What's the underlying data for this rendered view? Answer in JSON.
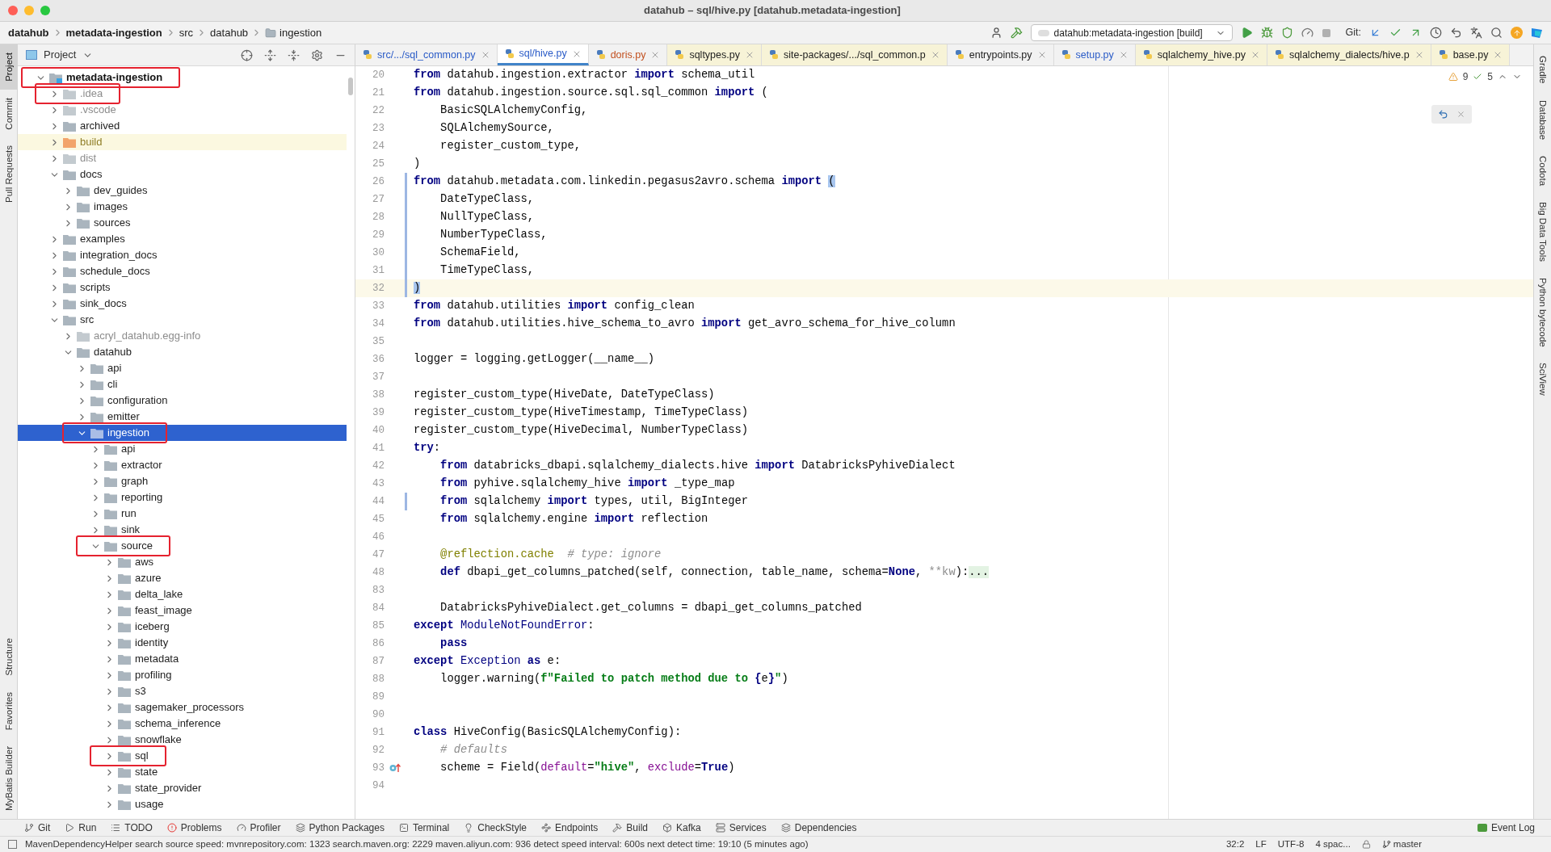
{
  "window": {
    "title": "datahub – sql/hive.py [datahub.metadata-ingestion]"
  },
  "breadcrumbs": [
    {
      "label": "datahub",
      "kind": "project"
    },
    {
      "label": "metadata-ingestion",
      "kind": "project"
    },
    {
      "label": "src",
      "kind": "package"
    },
    {
      "label": "datahub",
      "kind": "package"
    },
    {
      "label": "ingestion",
      "kind": "folder"
    }
  ],
  "toolbar": {
    "run_config": "datahub:metadata-ingestion [build]",
    "vcs_label": "Git:"
  },
  "left_strip": {
    "top": [
      {
        "label": "Project",
        "selected": true
      },
      {
        "label": "Commit",
        "selected": false
      },
      {
        "label": "Pull Requests",
        "selected": false
      }
    ],
    "bottom": [
      {
        "label": "Structure",
        "selected": false
      },
      {
        "label": "Favorites",
        "selected": false
      },
      {
        "label": "MyBatis Builder",
        "selected": false
      }
    ]
  },
  "project_panel": {
    "title": "Project",
    "tree": [
      {
        "name": "metadata-ingestion",
        "kind": "module",
        "expanded": true,
        "selected": false,
        "marked": true,
        "children": [
          {
            "name": ".idea",
            "kind": "excluded",
            "expanded": false,
            "selected": false,
            "marked": true
          },
          {
            "name": ".vscode",
            "kind": "excluded",
            "expanded": false,
            "selected": false,
            "marked": false
          },
          {
            "name": "archived",
            "kind": "folder",
            "expanded": false,
            "selected": false,
            "marked": false
          },
          {
            "name": "build",
            "kind": "output",
            "expanded": false,
            "selected": false,
            "marked": false
          },
          {
            "name": "dist",
            "kind": "excluded",
            "expanded": false,
            "selected": false,
            "marked": false
          },
          {
            "name": "docs",
            "kind": "folder",
            "expanded": true,
            "selected": false,
            "marked": false,
            "children": [
              {
                "name": "dev_guides",
                "kind": "folder",
                "expanded": false,
                "selected": false,
                "marked": false
              },
              {
                "name": "images",
                "kind": "folder",
                "expanded": false,
                "selected": false,
                "marked": false
              },
              {
                "name": "sources",
                "kind": "folder",
                "expanded": false,
                "selected": false,
                "marked": false
              }
            ]
          },
          {
            "name": "examples",
            "kind": "folder",
            "expanded": false,
            "selected": false,
            "marked": false
          },
          {
            "name": "integration_docs",
            "kind": "folder",
            "expanded": false,
            "selected": false,
            "marked": false
          },
          {
            "name": "schedule_docs",
            "kind": "folder",
            "expanded": false,
            "selected": false,
            "marked": false
          },
          {
            "name": "scripts",
            "kind": "folder",
            "expanded": false,
            "selected": false,
            "marked": false
          },
          {
            "name": "sink_docs",
            "kind": "folder",
            "expanded": false,
            "selected": false,
            "marked": false
          },
          {
            "name": "src",
            "kind": "folder",
            "expanded": true,
            "selected": false,
            "marked": false,
            "children": [
              {
                "name": "acryl_datahub.egg-info",
                "kind": "excluded",
                "expanded": false,
                "selected": false,
                "marked": false
              },
              {
                "name": "datahub",
                "kind": "folder",
                "expanded": true,
                "selected": false,
                "marked": false,
                "children": [
                  {
                    "name": "api",
                    "kind": "folder",
                    "expanded": false,
                    "selected": false,
                    "marked": false
                  },
                  {
                    "name": "cli",
                    "kind": "folder",
                    "expanded": false,
                    "selected": false,
                    "marked": false
                  },
                  {
                    "name": "configuration",
                    "kind": "folder",
                    "expanded": false,
                    "selected": false,
                    "marked": false
                  },
                  {
                    "name": "emitter",
                    "kind": "folder",
                    "expanded": false,
                    "selected": false,
                    "marked": false
                  },
                  {
                    "name": "ingestion",
                    "kind": "folder",
                    "expanded": true,
                    "selected": true,
                    "marked": true,
                    "children": [
                      {
                        "name": "api",
                        "kind": "folder",
                        "expanded": false,
                        "selected": false,
                        "marked": false
                      },
                      {
                        "name": "extractor",
                        "kind": "folder",
                        "expanded": false,
                        "selected": false,
                        "marked": false
                      },
                      {
                        "name": "graph",
                        "kind": "folder",
                        "expanded": false,
                        "selected": false,
                        "marked": false
                      },
                      {
                        "name": "reporting",
                        "kind": "folder",
                        "expanded": false,
                        "selected": false,
                        "marked": false
                      },
                      {
                        "name": "run",
                        "kind": "folder",
                        "expanded": false,
                        "selected": false,
                        "marked": false
                      },
                      {
                        "name": "sink",
                        "kind": "folder",
                        "expanded": false,
                        "selected": false,
                        "marked": false
                      },
                      {
                        "name": "source",
                        "kind": "folder",
                        "expanded": true,
                        "selected": false,
                        "marked": true,
                        "children": [
                          {
                            "name": "aws",
                            "kind": "folder",
                            "expanded": false,
                            "selected": false,
                            "marked": false
                          },
                          {
                            "name": "azure",
                            "kind": "folder",
                            "expanded": false,
                            "selected": false,
                            "marked": false
                          },
                          {
                            "name": "delta_lake",
                            "kind": "folder",
                            "expanded": false,
                            "selected": false,
                            "marked": false
                          },
                          {
                            "name": "feast_image",
                            "kind": "folder",
                            "expanded": false,
                            "selected": false,
                            "marked": false
                          },
                          {
                            "name": "iceberg",
                            "kind": "folder",
                            "expanded": false,
                            "selected": false,
                            "marked": false
                          },
                          {
                            "name": "identity",
                            "kind": "folder",
                            "expanded": false,
                            "selected": false,
                            "marked": false
                          },
                          {
                            "name": "metadata",
                            "kind": "folder",
                            "expanded": false,
                            "selected": false,
                            "marked": false
                          },
                          {
                            "name": "profiling",
                            "kind": "folder",
                            "expanded": false,
                            "selected": false,
                            "marked": false
                          },
                          {
                            "name": "s3",
                            "kind": "folder",
                            "expanded": false,
                            "selected": false,
                            "marked": false
                          },
                          {
                            "name": "sagemaker_processors",
                            "kind": "folder",
                            "expanded": false,
                            "selected": false,
                            "marked": false
                          },
                          {
                            "name": "schema_inference",
                            "kind": "folder",
                            "expanded": false,
                            "selected": false,
                            "marked": false
                          },
                          {
                            "name": "snowflake",
                            "kind": "folder",
                            "expanded": false,
                            "selected": false,
                            "marked": false
                          },
                          {
                            "name": "sql",
                            "kind": "folder",
                            "expanded": false,
                            "selected": false,
                            "marked": true
                          },
                          {
                            "name": "state",
                            "kind": "folder",
                            "expanded": false,
                            "selected": false,
                            "marked": false
                          },
                          {
                            "name": "state_provider",
                            "kind": "folder",
                            "expanded": false,
                            "selected": false,
                            "marked": false
                          },
                          {
                            "name": "usage",
                            "kind": "folder",
                            "expanded": false,
                            "selected": false,
                            "marked": false
                          }
                        ]
                      }
                    ]
                  }
                ]
              }
            ]
          }
        ]
      }
    ]
  },
  "editor": {
    "tabs": [
      {
        "label": "src/.../sql_common.py",
        "selected": false,
        "kind": "modified",
        "external": false
      },
      {
        "label": "sql/hive.py",
        "selected": true,
        "kind": "modified"
      },
      {
        "label": "doris.py",
        "selected": false,
        "kind": "unversioned",
        "external": false
      },
      {
        "label": "sqltypes.py",
        "selected": false,
        "kind": "normal",
        "external": true
      },
      {
        "label": "site-packages/.../sql_common.p",
        "selected": false,
        "kind": "normal",
        "external": true
      },
      {
        "label": "entrypoints.py",
        "selected": false,
        "kind": "normal",
        "external": false
      },
      {
        "label": "setup.py",
        "selected": false,
        "kind": "modified",
        "external": false
      },
      {
        "label": "sqlalchemy_hive.py",
        "selected": false,
        "kind": "normal",
        "external": true
      },
      {
        "label": "sqlalchemy_dialects/hive.p",
        "selected": false,
        "kind": "normal",
        "external": true
      },
      {
        "label": "base.py",
        "selected": false,
        "kind": "normal",
        "external": true
      }
    ],
    "inspections": {
      "warnings": "9",
      "checks": "5"
    },
    "lines": [
      {
        "number": "20",
        "current": false,
        "changed": false,
        "tokens": [
          {
            "kind": "kw",
            "text": "from"
          },
          {
            "kind": "plain",
            "text": " datahub.ingestion.extractor "
          },
          {
            "kind": "kw",
            "text": "import"
          },
          {
            "kind": "plain",
            "text": " schema_util"
          }
        ]
      },
      {
        "number": "21",
        "current": false,
        "changed": false,
        "tokens": [
          {
            "kind": "kw",
            "text": "from"
          },
          {
            "kind": "plain",
            "text": " datahub.ingestion.source.sql.sql_common "
          },
          {
            "kind": "kw",
            "text": "import"
          },
          {
            "kind": "plain",
            "text": " ("
          }
        ]
      },
      {
        "number": "22",
        "current": false,
        "changed": false,
        "tokens": [
          {
            "kind": "plain",
            "text": "    BasicSQLAlchemyConfig,"
          }
        ]
      },
      {
        "number": "23",
        "current": false,
        "changed": false,
        "tokens": [
          {
            "kind": "plain",
            "text": "    SQLAlchemySource,"
          }
        ]
      },
      {
        "number": "24",
        "current": false,
        "changed": false,
        "tokens": [
          {
            "kind": "plain",
            "text": "    register_custom_type,"
          }
        ]
      },
      {
        "number": "25",
        "current": false,
        "changed": false,
        "tokens": [
          {
            "kind": "plain",
            "text": ")"
          }
        ]
      },
      {
        "number": "26",
        "current": false,
        "changed": true,
        "tokens": [
          {
            "kind": "kw",
            "text": "from"
          },
          {
            "kind": "plain",
            "text": " datahub.metadata.com.linkedin.pegasus2avro.schema "
          },
          {
            "kind": "kw",
            "text": "import"
          },
          {
            "kind": "match",
            "text": " ("
          }
        ]
      },
      {
        "number": "27",
        "current": false,
        "changed": true,
        "tokens": [
          {
            "kind": "plain",
            "text": "    DateTypeClass,"
          }
        ]
      },
      {
        "number": "28",
        "current": false,
        "changed": true,
        "tokens": [
          {
            "kind": "plain",
            "text": "    NullTypeClass,"
          }
        ]
      },
      {
        "number": "29",
        "current": false,
        "changed": true,
        "tokens": [
          {
            "kind": "plain",
            "text": "    NumberTypeClass,"
          }
        ]
      },
      {
        "number": "30",
        "current": false,
        "changed": true,
        "tokens": [
          {
            "kind": "plain",
            "text": "    SchemaField,"
          }
        ]
      },
      {
        "number": "31",
        "current": false,
        "changed": true,
        "tokens": [
          {
            "kind": "plain",
            "text": "    TimeTypeClass,"
          }
        ]
      },
      {
        "number": "32",
        "current": true,
        "changed": true,
        "tokens": [
          {
            "kind": "match",
            "text": ")"
          }
        ]
      },
      {
        "number": "33",
        "current": false,
        "changed": false,
        "tokens": [
          {
            "kind": "kw",
            "text": "from"
          },
          {
            "kind": "plain",
            "text": " datahub.utilities "
          },
          {
            "kind": "kw",
            "text": "import"
          },
          {
            "kind": "plain",
            "text": " config_clean"
          }
        ]
      },
      {
        "number": "34",
        "current": false,
        "changed": false,
        "tokens": [
          {
            "kind": "kw",
            "text": "from"
          },
          {
            "kind": "plain",
            "text": " datahub.utilities.hive_schema_to_avro "
          },
          {
            "kind": "kw",
            "text": "import"
          },
          {
            "kind": "plain",
            "text": " get_avro_schema_for_hive_column"
          }
        ]
      },
      {
        "number": "35",
        "current": false,
        "changed": false
      },
      {
        "number": "36",
        "current": false,
        "changed": false,
        "tokens": [
          {
            "kind": "plain",
            "text": "logger = logging.getLogger(__name__)"
          }
        ]
      },
      {
        "number": "37",
        "current": false,
        "changed": false
      },
      {
        "number": "38",
        "current": false,
        "changed": false,
        "tokens": [
          {
            "kind": "plain",
            "text": "register_custom_type(HiveDate, DateTypeClass)"
          }
        ]
      },
      {
        "number": "39",
        "current": false,
        "changed": false,
        "tokens": [
          {
            "kind": "plain",
            "text": "register_custom_type(HiveTimestamp, TimeTypeClass)"
          }
        ]
      },
      {
        "number": "40",
        "current": false,
        "changed": false,
        "tokens": [
          {
            "kind": "plain",
            "text": "register_custom_type(HiveDecimal, NumberTypeClass)"
          }
        ]
      },
      {
        "number": "41",
        "current": false,
        "changed": false,
        "tokens": [
          {
            "kind": "kw",
            "text": "try"
          },
          {
            "kind": "plain",
            "text": ":"
          }
        ]
      },
      {
        "number": "42",
        "current": false,
        "changed": false,
        "tokens": [
          {
            "kind": "kw",
            "text": "    from"
          },
          {
            "kind": "plain",
            "text": " databricks_dbapi.sqlalchemy_dialects.hive "
          },
          {
            "kind": "kw",
            "text": "import"
          },
          {
            "kind": "plain",
            "text": " DatabricksPyhiveDialect"
          }
        ]
      },
      {
        "number": "43",
        "current": false,
        "changed": false,
        "tokens": [
          {
            "kind": "kw",
            "text": "    from"
          },
          {
            "kind": "plain",
            "text": " pyhive.sqlalchemy_hive "
          },
          {
            "kind": "kw",
            "text": "import"
          },
          {
            "kind": "plain",
            "text": " _type_map"
          }
        ]
      },
      {
        "number": "44",
        "current": false,
        "changed": true,
        "tokens": [
          {
            "kind": "kw",
            "text": "    from"
          },
          {
            "kind": "plain",
            "text": " sqlalchemy "
          },
          {
            "kind": "kw",
            "text": "import"
          },
          {
            "kind": "plain",
            "text": " types, util, BigInteger"
          }
        ]
      },
      {
        "number": "45",
        "current": false,
        "changed": false,
        "tokens": [
          {
            "kind": "kw",
            "text": "    from"
          },
          {
            "kind": "plain",
            "text": " sqlalchemy.engine "
          },
          {
            "kind": "kw",
            "text": "import"
          },
          {
            "kind": "plain",
            "text": " reflection"
          }
        ]
      },
      {
        "number": "46",
        "current": false,
        "changed": false
      },
      {
        "number": "47",
        "current": false,
        "changed": false,
        "tokens": [
          {
            "kind": "deco",
            "text": "    @reflection.cache"
          },
          {
            "kind": "comment",
            "text": "  # type: ignore"
          }
        ]
      },
      {
        "number": "48",
        "current": false,
        "changed": false,
        "tokens": [
          {
            "kind": "kw",
            "text": "    def"
          },
          {
            "kind": "plain",
            "text": " dbapi_get_columns_patched(self, connection, table_name, schema="
          },
          {
            "kind": "kw",
            "text": "None"
          },
          {
            "kind": "plain",
            "text": ", "
          },
          {
            "kind": "dim",
            "text": "**kw"
          },
          {
            "kind": "plain",
            "text": "):"
          },
          {
            "kind": "folded",
            "text": "..."
          }
        ]
      },
      {
        "number": "83",
        "current": false,
        "changed": false
      },
      {
        "number": "84",
        "current": false,
        "changed": false,
        "tokens": [
          {
            "kind": "plain",
            "text": "    DatabricksPyhiveDialect.get_columns = dbapi_get_columns_patched"
          }
        ]
      },
      {
        "number": "85",
        "current": false,
        "changed": false,
        "tokens": [
          {
            "kind": "kw",
            "text": "except"
          },
          {
            "kind": "builtin",
            "text": " ModuleNotFoundError"
          },
          {
            "kind": "plain",
            "text": ":"
          }
        ]
      },
      {
        "number": "86",
        "current": false,
        "changed": false,
        "tokens": [
          {
            "kind": "kw",
            "text": "    pass"
          }
        ]
      },
      {
        "number": "87",
        "current": false,
        "changed": false,
        "tokens": [
          {
            "kind": "kw",
            "text": "except"
          },
          {
            "kind": "builtin",
            "text": " Exception"
          },
          {
            "kind": "kw",
            "text": " as"
          },
          {
            "kind": "plain",
            "text": " e:"
          }
        ]
      },
      {
        "number": "88",
        "current": false,
        "changed": false,
        "tokens": [
          {
            "kind": "plain",
            "text": "    logger.warning("
          },
          {
            "kind": "str",
            "text": "f\"Failed to patch method due to "
          },
          {
            "kind": "kw",
            "text": "{"
          },
          {
            "kind": "plain",
            "text": "e"
          },
          {
            "kind": "kw",
            "text": "}"
          },
          {
            "kind": "str",
            "text": "\""
          },
          {
            "kind": "plain",
            "text": ")"
          }
        ]
      },
      {
        "number": "89",
        "current": false,
        "changed": false
      },
      {
        "number": "90",
        "current": false,
        "changed": false
      },
      {
        "number": "91",
        "current": false,
        "changed": false,
        "tokens": [
          {
            "kind": "kw",
            "text": "class"
          },
          {
            "kind": "plain",
            "text": " HiveConfig(BasicSQLAlchemyConfig):"
          }
        ]
      },
      {
        "number": "92",
        "current": false,
        "changed": false,
        "tokens": [
          {
            "kind": "comment",
            "text": "    # defaults"
          }
        ]
      },
      {
        "number": "93",
        "current": false,
        "changed": false,
        "overrides": true,
        "tokens": [
          {
            "kind": "plain",
            "text": "    scheme = Field("
          },
          {
            "kind": "param",
            "text": "default"
          },
          {
            "kind": "plain",
            "text": "="
          },
          {
            "kind": "str",
            "text": "\"hive\""
          },
          {
            "kind": "plain",
            "text": ", "
          },
          {
            "kind": "param",
            "text": "exclude"
          },
          {
            "kind": "plain",
            "text": "="
          },
          {
            "kind": "kw",
            "text": "True"
          },
          {
            "kind": "plain",
            "text": ")"
          }
        ]
      },
      {
        "number": "94",
        "current": false,
        "changed": false
      }
    ]
  },
  "right_strip": [
    "Gradle",
    "Database",
    "Codota",
    "Big Data Tools",
    "Python bytecode",
    "SciView"
  ],
  "tool_windows": [
    "Git",
    "Run",
    "TODO",
    "Problems",
    "Profiler",
    "Python Packages",
    "Terminal",
    "CheckStyle",
    "Endpoints",
    "Build",
    "Kafka",
    "Services",
    "Dependencies"
  ],
  "event_log": "Event Log",
  "status_bar": {
    "message": "MavenDependencyHelper search source speed: mvnrepository.com: 1323 search.maven.org: 2229 maven.aliyun.com: 936 detect speed interval: 600s next detect time: 19:10 (5 minutes ago)",
    "position": "32:2",
    "line_separator": "LF",
    "encoding": "UTF-8",
    "indent": "4 spac...",
    "branch": "master"
  }
}
